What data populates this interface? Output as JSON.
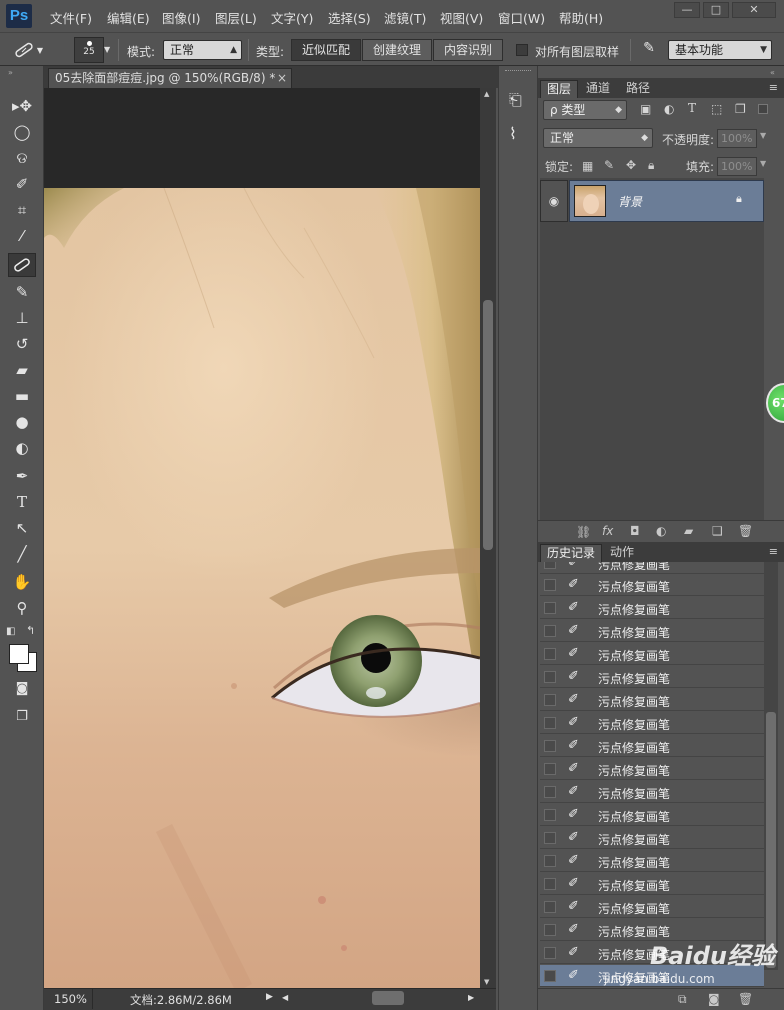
{
  "app": {
    "logo": "Ps"
  },
  "menu": [
    "文件(F)",
    "编辑(E)",
    "图像(I)",
    "图层(L)",
    "文字(Y)",
    "选择(S)",
    "滤镜(T)",
    "视图(V)",
    "窗口(W)",
    "帮助(H)"
  ],
  "window_controls": {
    "minimize": "—",
    "maximize": "□",
    "close": "✕"
  },
  "options": {
    "brush_size": "25",
    "mode_label": "模式:",
    "mode_value": "正常",
    "type_label": "类型:",
    "type_options": [
      "近似匹配",
      "创建纹理",
      "内容识别"
    ],
    "type_active": 0,
    "sample_all_label": "对所有图层取样",
    "workspace": "基本功能"
  },
  "document": {
    "tab_title": "05去除面部痘痘.jpg @ 150%(RGB/8) *",
    "tab_close": "×",
    "zoom": "150%",
    "doc_info": "文档:2.86M/2.86M"
  },
  "layers_panel": {
    "tabs": [
      "图层",
      "通道",
      "路径"
    ],
    "filter_label": "ρ 类型",
    "blend_mode": "正常",
    "opacity_label": "不透明度:",
    "opacity_value": "100%",
    "lock_label": "锁定:",
    "fill_label": "填充:",
    "fill_value": "100%",
    "layer_name": "背景"
  },
  "history_panel": {
    "tabs": [
      "历史记录",
      "动作"
    ],
    "partial_item": "污点修复画笔",
    "items": [
      "污点修复画笔",
      "污点修复画笔",
      "污点修复画笔",
      "污点修复画笔",
      "污点修复画笔",
      "污点修复画笔",
      "污点修复画笔",
      "污点修复画笔",
      "污点修复画笔",
      "污点修复画笔",
      "污点修复画笔",
      "污点修复画笔",
      "污点修复画笔",
      "污点修复画笔",
      "污点修复画笔",
      "污点修复画笔",
      "污点修复画笔",
      "污点修复画笔"
    ],
    "selected_index": 17
  },
  "badge": {
    "text": "67"
  },
  "watermark": {
    "brand": "Baidu经验",
    "url": "jingyan.baidu.com"
  }
}
